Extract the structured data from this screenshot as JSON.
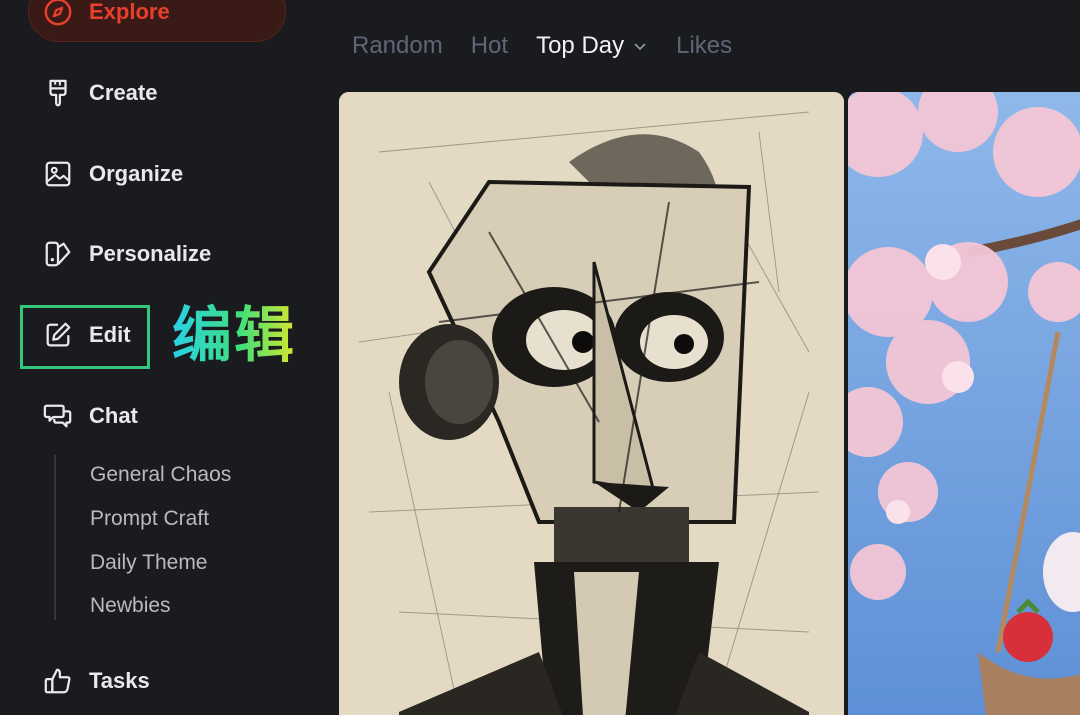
{
  "sidebar": {
    "items": {
      "explore": {
        "label": "Explore",
        "icon": "compass-icon"
      },
      "create": {
        "label": "Create",
        "icon": "brush-icon"
      },
      "organize": {
        "label": "Organize",
        "icon": "image-icon"
      },
      "personalize": {
        "label": "Personalize",
        "icon": "palette-icon"
      },
      "edit": {
        "label": "Edit",
        "icon": "edit-icon"
      },
      "chat": {
        "label": "Chat",
        "icon": "chat-icon"
      },
      "tasks": {
        "label": "Tasks",
        "icon": "thumbs-up-icon"
      }
    },
    "chat_channels": [
      "General Chaos",
      "Prompt Craft",
      "Daily Theme",
      "Newbies"
    ]
  },
  "annotation": {
    "edit_chinese": "编辑"
  },
  "tabs": {
    "random": "Random",
    "hot": "Hot",
    "top_day": "Top Day",
    "likes": "Likes",
    "active": "top_day"
  },
  "gallery": {
    "cards": [
      {
        "subject": "cubist-sketch-portrait"
      },
      {
        "subject": "cherry-blossom-swing"
      }
    ]
  },
  "colors": {
    "background": "#1a1b1f",
    "accent": "#e8402c",
    "highlight": "#34c77b",
    "tab_inactive": "#5f6677",
    "tab_active": "#f2f2f4"
  }
}
